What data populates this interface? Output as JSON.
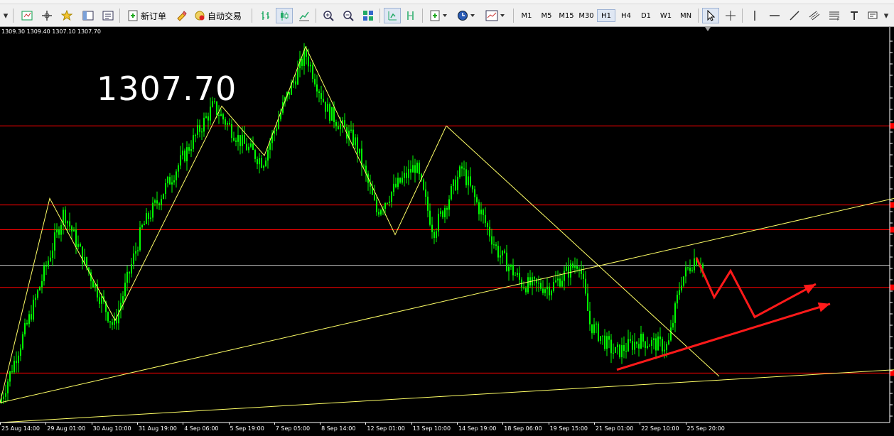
{
  "toolbar": {
    "new_order_label": "新订单",
    "auto_trading_label": "自动交易",
    "timeframes": [
      "M1",
      "M5",
      "M15",
      "M30",
      "H1",
      "H4",
      "D1",
      "W1",
      "MN"
    ],
    "active_timeframe": "H1"
  },
  "chart": {
    "ohlc_readout": "1309.30 1309.40 1307.10 1307.70",
    "current_price": "1307.70"
  },
  "colors": {
    "background": "#000000",
    "candle": "#00ff00",
    "horizontal_level": "#ff0000",
    "trendline": "#ffff66",
    "bid_line": "#c0c0c0",
    "arrow": "#ff1a1a"
  },
  "chart_data": {
    "type": "line",
    "x_axis_labels": [
      "25 Aug 14:00",
      "29 Aug 01:00",
      "30 Aug 10:00",
      "31 Aug 19:00",
      "4 Sep 06:00",
      "5 Sep 19:00",
      "7 Sep 05:00",
      "8 Sep 14:00",
      "12 Sep 01:00",
      "13 Sep 10:00",
      "14 Sep 19:00",
      "18 Sep 06:00",
      "19 Sep 15:00",
      "21 Sep 01:00",
      "22 Sep 10:00",
      "25 Sep 20:00"
    ],
    "price_path": [
      {
        "t": 0,
        "p": 1266
      },
      {
        "t": 45,
        "p": 1294
      },
      {
        "t": 90,
        "p": 1324
      },
      {
        "t": 120,
        "p": 1308
      },
      {
        "t": 160,
        "p": 1289
      },
      {
        "t": 200,
        "p": 1319
      },
      {
        "t": 240,
        "p": 1334
      },
      {
        "t": 300,
        "p": 1356
      },
      {
        "t": 340,
        "p": 1345
      },
      {
        "t": 370,
        "p": 1339
      },
      {
        "t": 400,
        "p": 1357
      },
      {
        "t": 430,
        "p": 1372
      },
      {
        "t": 460,
        "p": 1355
      },
      {
        "t": 500,
        "p": 1345
      },
      {
        "t": 530,
        "p": 1324
      },
      {
        "t": 555,
        "p": 1331
      },
      {
        "t": 585,
        "p": 1338
      },
      {
        "t": 610,
        "p": 1318
      },
      {
        "t": 650,
        "p": 1337
      },
      {
        "t": 700,
        "p": 1312
      },
      {
        "t": 735,
        "p": 1302
      },
      {
        "t": 775,
        "p": 1301
      },
      {
        "t": 815,
        "p": 1309
      },
      {
        "t": 830,
        "p": 1290
      },
      {
        "t": 865,
        "p": 1281
      },
      {
        "t": 900,
        "p": 1285
      },
      {
        "t": 940,
        "p": 1283
      },
      {
        "t": 958,
        "p": 1303
      },
      {
        "t": 978,
        "p": 1310
      },
      {
        "t": 990,
        "p": 1307.7
      }
    ],
    "horizontal_levels": [
      1350,
      1326,
      1318.5,
      1301,
      1275
    ],
    "bid_level": 1307.7,
    "trendlines": [
      {
        "from": {
          "t": 0,
          "p": 1266
        },
        "to": {
          "t": 1258,
          "p": 1328
        }
      },
      {
        "from": {
          "t": 0,
          "p": 1260
        },
        "to": {
          "t": 1258,
          "p": 1276
        }
      },
      {
        "from": {
          "t": 628,
          "p": 1350
        },
        "to": {
          "t": 1012,
          "p": 1274
        }
      }
    ],
    "zigzag": [
      {
        "t": 0,
        "p": 1266
      },
      {
        "t": 70,
        "p": 1328
      },
      {
        "t": 162,
        "p": 1291
      },
      {
        "t": 312,
        "p": 1356
      },
      {
        "t": 372,
        "p": 1341
      },
      {
        "t": 430,
        "p": 1374
      },
      {
        "t": 556,
        "p": 1317
      },
      {
        "t": 628,
        "p": 1350
      }
    ],
    "forecast_arrows": [
      [
        {
          "t": 980,
          "p": 1310
        },
        {
          "t": 1005,
          "p": 1298
        },
        {
          "t": 1028,
          "p": 1306
        },
        {
          "t": 1062,
          "p": 1292
        },
        {
          "t": 1148,
          "p": 1302
        }
      ],
      [
        {
          "t": 868,
          "p": 1276
        },
        {
          "t": 1168,
          "p": 1296
        }
      ]
    ],
    "y_range": [
      1260,
      1380
    ],
    "grid": false
  }
}
